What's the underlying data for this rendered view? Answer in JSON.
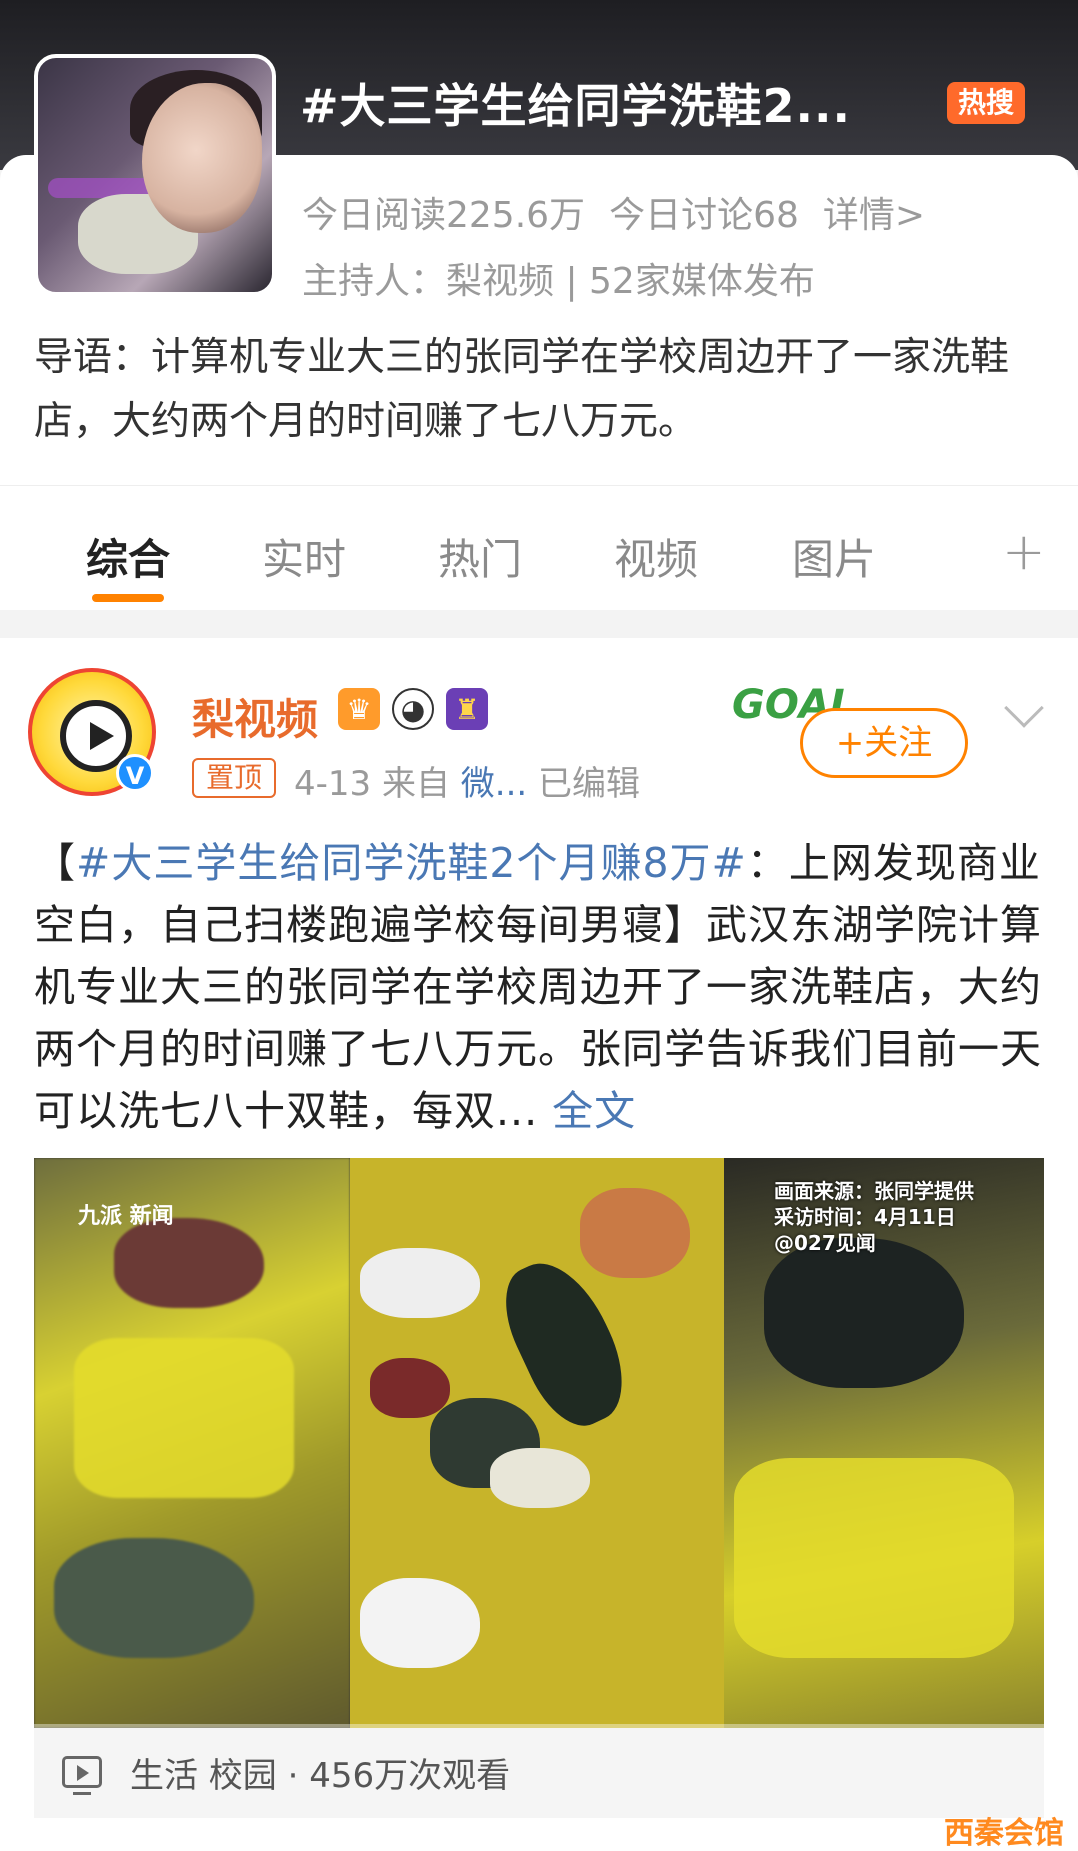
{
  "topic": {
    "title": "#大三学生给同学洗鞋2...",
    "hot_badge": "热搜",
    "reads": "今日阅读225.6万",
    "discussions": "今日讨论68",
    "details_link": "详情>",
    "host": "主持人：梨视频 | 52家媒体发布",
    "intro": "导语：计算机专业大三的张同学在学校周边开了一家洗鞋店，大约两个月的时间赚了七八万元。"
  },
  "tabs": [
    {
      "label": "综合",
      "active": true
    },
    {
      "label": "实时"
    },
    {
      "label": "热门"
    },
    {
      "label": "视频"
    },
    {
      "label": "图片"
    }
  ],
  "tabs_add_label": "+",
  "post": {
    "user_name": "梨视频",
    "pin_label": "置顶",
    "date": "4-13",
    "source_prefix": "来自",
    "source": "微...",
    "edited": "已编辑",
    "follow_label": "+关注",
    "decoration_text": "GOAL",
    "text_open": "【",
    "hashtag": "#大三学生给同学洗鞋2个月赚8万#",
    "text_body": "：上网发现商业空白，自己扫楼跑遍学校每间男寝】武汉东湖学院计算机专业大三的张同学在学校周边开了一家洗鞋店，大约两个月的时间赚了七八万元。张同学告诉我们目前一天可以洗七八十双鞋，每双...",
    "more_label": "全文",
    "video": {
      "logo_text": "九派 新闻",
      "source_line1": "画面来源：张同学提供",
      "source_line2": "采访时间：4月11日",
      "source_line3": "@027见闻"
    },
    "video_meta": "生活 校园 · 456万次观看"
  },
  "site_watermark": "西秦会馆",
  "colors": {
    "accent": "#ff8200",
    "link": "#4a78b4",
    "hot": "#ff6a2b",
    "username": "#e86b2c"
  }
}
